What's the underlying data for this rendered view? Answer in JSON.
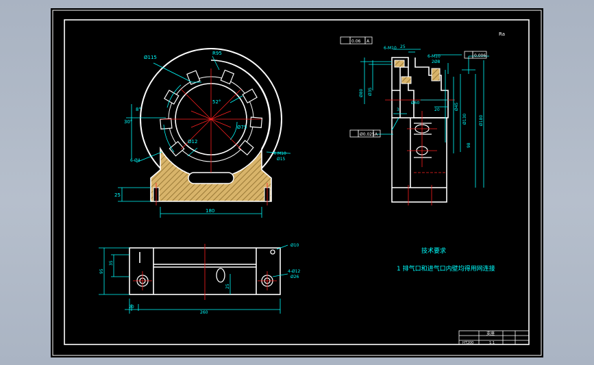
{
  "drawing": {
    "tech_req_title": "技术要求",
    "tech_req_line1": "1 排气口和进气口内壁均得用网连接",
    "front_view": {
      "dims": {
        "phi115": "Ø115",
        "r95": "R95",
        "a52": "52°",
        "phi75": "Ø75",
        "phi12": "Ø12",
        "a8": "8°",
        "a30": "30°",
        "phi4_6": "6-Ø4",
        "holes_m10": "4-M10",
        "phi15": "Ø15",
        "d25": "25",
        "d180": "180"
      }
    },
    "side_view": {
      "dims": {
        "m10_top": "6-M10",
        "d25_top": "25",
        "m10_right": "6-M10",
        "d25_right": "2Ø8",
        "tol_flat": "0.006",
        "tol_parallel": "0.06",
        "phi80": "Ø80",
        "phi35": "Ø35",
        "phi60": "Ø60",
        "d20": "20",
        "phi45": "Ø45",
        "phi130": "Ø130",
        "phi180": "Ø180",
        "d98": "98",
        "d3": "3",
        "tol_perp": "Ø0.025",
        "datum": "A",
        "roughness": "Ra"
      }
    },
    "plan_view": {
      "dims": {
        "phi10": "Ø10",
        "holes_phi12": "4-Ø12",
        "phi26": "Ø26",
        "d35": "35",
        "d95": "95",
        "d25": "25",
        "d20": "20",
        "d260": "260"
      }
    },
    "title_block": {
      "name": "支座",
      "scale": "1:1",
      "material": "HT200"
    }
  }
}
